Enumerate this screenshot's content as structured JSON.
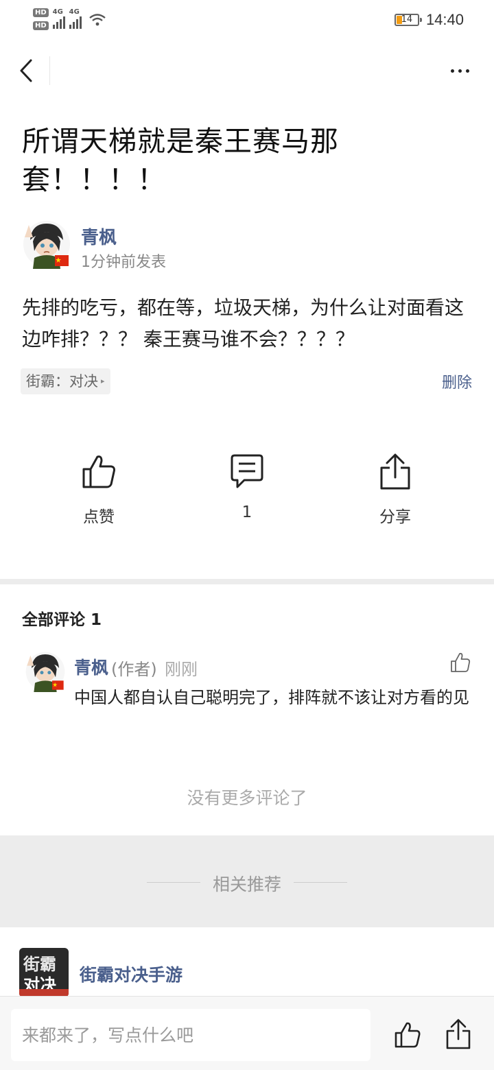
{
  "status_bar": {
    "hd1": "HD",
    "hd2": "HD",
    "net1": "4G",
    "net2": "4G",
    "battery": "14",
    "time": "14:40"
  },
  "post": {
    "title": "所谓天梯就是秦王赛马那套！！！！",
    "author_name": "青枫",
    "author_time": "1分钟前发表",
    "body": "先排的吃亏，都在等，垃圾天梯，为什么让对面看这边咋排？？？ 秦王赛马谁不会？？？？",
    "tag": "街霸：对决",
    "delete_label": "删除"
  },
  "actions": {
    "like_label": "点赞",
    "comment_count": "1",
    "share_label": "分享"
  },
  "comments": {
    "header": "全部评论 1",
    "items": [
      {
        "name": "青枫",
        "role": "(作者)",
        "time": "刚刚",
        "text": "中国人都自认自己聪明完了，排阵就不该让对方看的见"
      }
    ],
    "no_more": "没有更多评论了"
  },
  "related": {
    "header": "相关推荐",
    "items": [
      {
        "title": "街霸对决手游",
        "logo_line1": "街霸",
        "logo_line2": "对决"
      }
    ]
  },
  "bottom_bar": {
    "placeholder": "来都来了，写点什么吧"
  },
  "colors": {
    "link_blue": "#4a5f8c",
    "battery_orange": "#f39c12"
  }
}
